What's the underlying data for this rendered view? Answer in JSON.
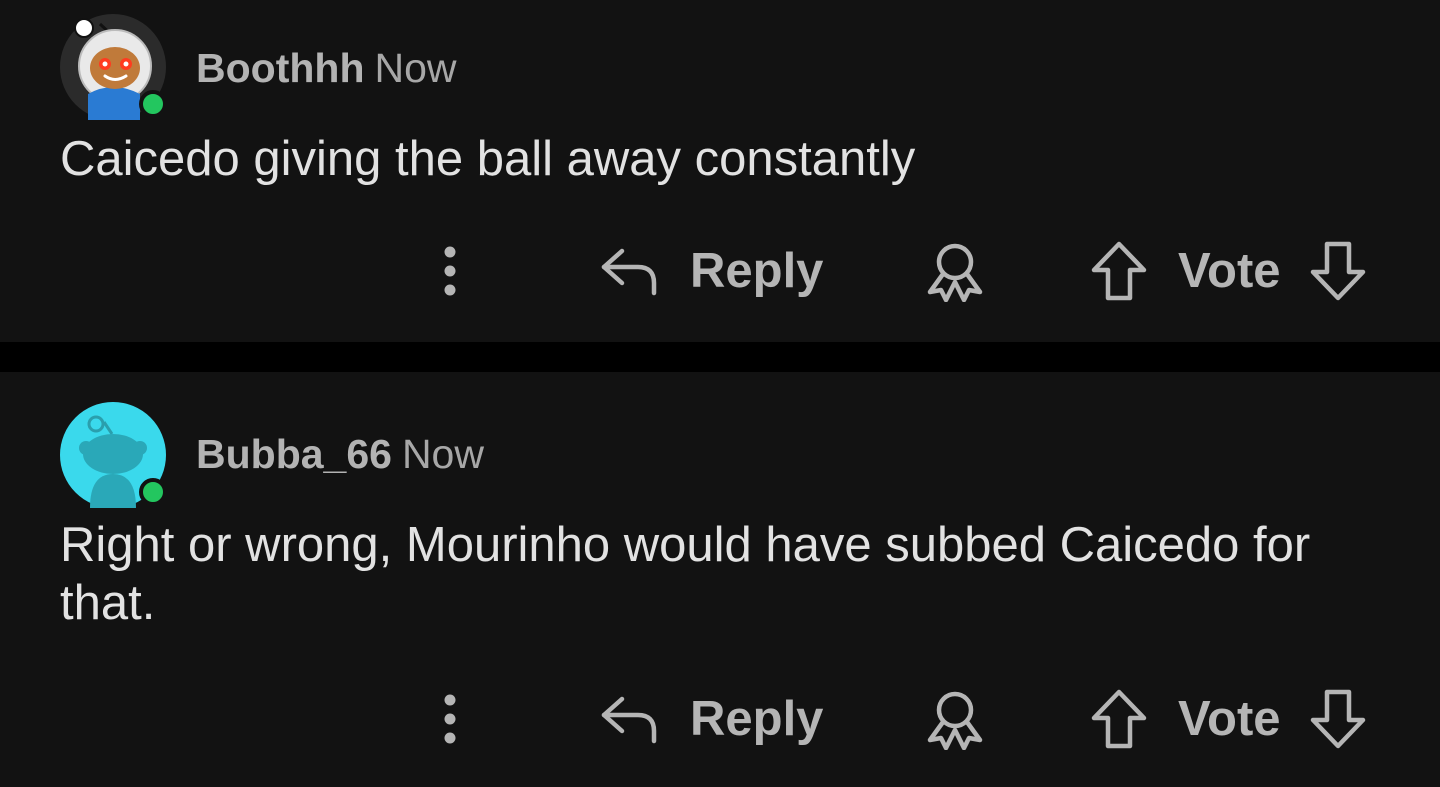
{
  "comments": [
    {
      "username": "Boothhh",
      "timestamp": "Now",
      "body": "Caicedo giving the ball away constantly",
      "avatar": "snoo-avatar-hooded-icon",
      "online_color": "#23c65f",
      "actions": {
        "more_icon": "more-vertical-icon",
        "reply_label": "Reply",
        "reply_icon": "reply-arrow-icon",
        "award_icon": "award-icon",
        "vote_label": "Vote",
        "upvote_icon": "upvote-arrow-icon",
        "downvote_icon": "downvote-arrow-icon"
      }
    },
    {
      "username": "Bubba_66",
      "timestamp": "Now",
      "body": "Right or wrong, Mourinho would have subbed Caicedo for that.",
      "avatar": "snoo-avatar-default-icon",
      "online_color": "#23c65f",
      "actions": {
        "more_icon": "more-vertical-icon",
        "reply_label": "Reply",
        "reply_icon": "reply-arrow-icon",
        "award_icon": "award-icon",
        "vote_label": "Vote",
        "upvote_icon": "upvote-arrow-icon",
        "downvote_icon": "downvote-arrow-icon"
      }
    }
  ],
  "theme": {
    "background": "#121212",
    "separator": "#000000",
    "text_primary": "#e2e2e2",
    "text_secondary": "#b5b5b5"
  }
}
